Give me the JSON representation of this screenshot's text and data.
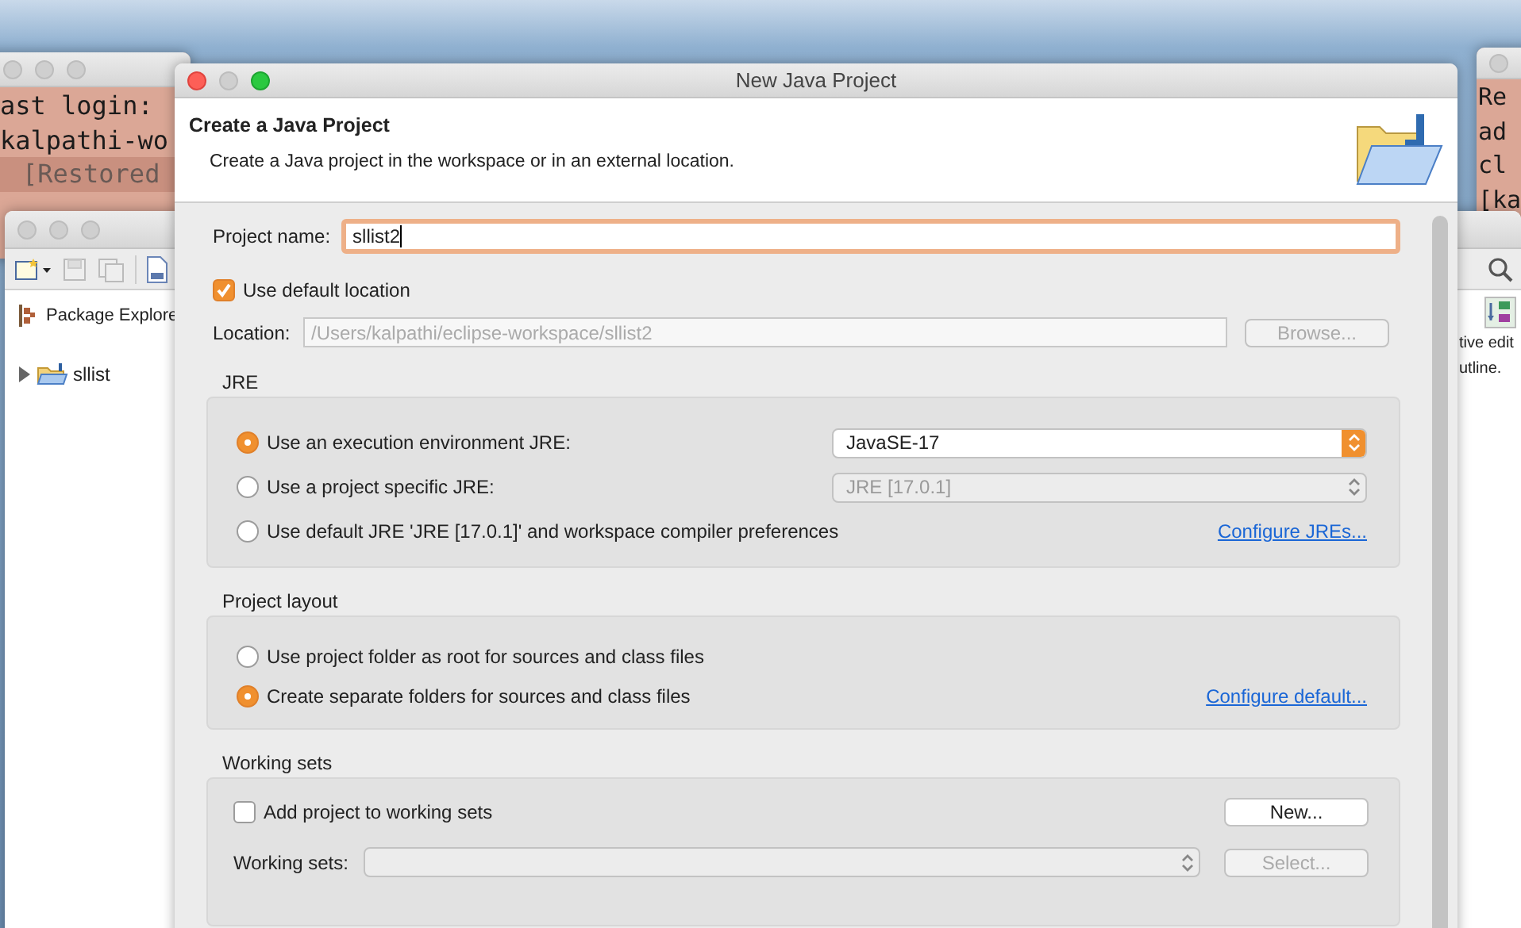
{
  "terminal_left": {
    "lines": [
      "ast login:",
      "kalpathi-wo",
      "[Restored"
    ]
  },
  "terminal_right": {
    "lines": [
      "Re",
      "ad",
      "cl",
      "[ka"
    ]
  },
  "eclipse": {
    "view_title": "Package Explore",
    "tree": [
      {
        "label": "sllist",
        "expanded": false
      }
    ],
    "outline_text": [
      "tive edit",
      "utline."
    ]
  },
  "dialog": {
    "title": "New Java Project",
    "heading": "Create a Java Project",
    "description": "Create a Java project in the workspace or in an external location.",
    "project_name": {
      "label": "Project name:",
      "value": "sllist2"
    },
    "use_default_location": {
      "label": "Use default location",
      "checked": true
    },
    "location": {
      "label": "Location:",
      "value": "/Users/kalpathi/eclipse-workspace/sllist2",
      "disabled": true
    },
    "browse_button": {
      "label": "Browse...",
      "disabled": true
    },
    "jre": {
      "title": "JRE",
      "options": [
        {
          "label": "Use an execution environment JRE:",
          "selected": true,
          "control": {
            "kind": "select",
            "value": "JavaSE-17",
            "disabled": false
          }
        },
        {
          "label": "Use a project specific JRE:",
          "selected": false,
          "control": {
            "kind": "select",
            "value": "JRE [17.0.1]",
            "disabled": true
          }
        },
        {
          "label": "Use default JRE 'JRE [17.0.1]' and workspace compiler preferences",
          "selected": false,
          "control": {
            "kind": "link",
            "label": "Configure JREs..."
          }
        }
      ]
    },
    "project_layout": {
      "title": "Project layout",
      "options": [
        {
          "label": "Use project folder as root for sources and class files",
          "selected": false
        },
        {
          "label": "Create separate folders for sources and class files",
          "selected": true,
          "control": {
            "kind": "link",
            "label": "Configure default..."
          }
        }
      ]
    },
    "working_sets": {
      "title": "Working sets",
      "add": {
        "label": "Add project to working sets",
        "checked": false
      },
      "new_button": {
        "label": "New...",
        "disabled": false
      },
      "select_label": "Working sets:",
      "select_button": {
        "label": "Select...",
        "disabled": true
      }
    }
  }
}
